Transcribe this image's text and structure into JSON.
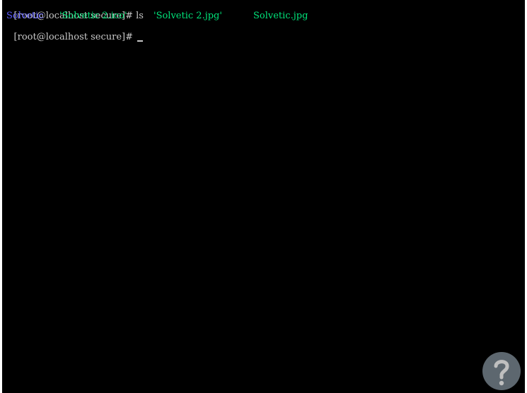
{
  "terminal": {
    "line1": {
      "prompt": "[root@localhost secure]#",
      "command": "ls"
    },
    "listing": [
      {
        "name": "Solvetic",
        "type": "directory",
        "color": "#5a5aff"
      },
      {
        "name": "'Solvetic 2.ico'",
        "type": "file",
        "color": "#00e47a"
      },
      {
        "name": "'Solvetic 2.jpg'",
        "type": "file",
        "color": "#00e47a"
      },
      {
        "name": "Solvetic.jpg",
        "type": "file",
        "color": "#00e47a"
      }
    ],
    "line3": {
      "prompt": "[root@localhost secure]#",
      "cursor": "_"
    },
    "colors": {
      "background": "#000000",
      "text": "#c8c8c8"
    }
  },
  "watermark": {
    "icon": "question-mark-icon"
  }
}
